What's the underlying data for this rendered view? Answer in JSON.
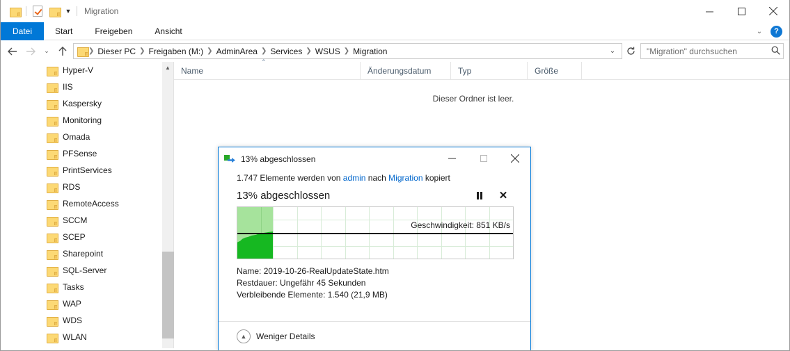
{
  "window": {
    "title": "Migration",
    "quick_access": [
      {
        "name": "folder-icon",
        "label": "Aktueller Ordner"
      },
      {
        "name": "properties-icon",
        "label": "Eigenschaften"
      },
      {
        "name": "new-folder-icon",
        "label": "Neuer Ordner"
      },
      {
        "name": "chevron-down-icon",
        "label": "Schnellzugriff anpassen"
      }
    ],
    "controls": {
      "minimize": "Minimieren",
      "maximize": "Maximieren",
      "close": "Schließen"
    }
  },
  "ribbon": {
    "tabs": [
      {
        "label": "Datei",
        "active": true
      },
      {
        "label": "Start",
        "active": false
      },
      {
        "label": "Freigeben",
        "active": false
      },
      {
        "label": "Ansicht",
        "active": false
      }
    ],
    "expand_icon": "chevron-down-icon",
    "help_label": "?"
  },
  "navigation": {
    "back": "◄",
    "forward": "►",
    "recent": "⌄",
    "up": "↑",
    "breadcrumbs": [
      "Dieser PC",
      "Freigaben (M:)",
      "AdminArea",
      "Services",
      "WSUS",
      "Migration"
    ],
    "dropdown_icon": "chevron-down-icon",
    "refresh_icon": "refresh-icon"
  },
  "search": {
    "placeholder": "\"Migration\" durchsuchen",
    "value": "",
    "icon": "search-icon"
  },
  "sidebar": {
    "items": [
      {
        "label": "Hyper-V"
      },
      {
        "label": "IIS"
      },
      {
        "label": "Kaspersky"
      },
      {
        "label": "Monitoring"
      },
      {
        "label": "Omada"
      },
      {
        "label": "PFSense"
      },
      {
        "label": "PrintServices"
      },
      {
        "label": "RDS"
      },
      {
        "label": "RemoteAccess"
      },
      {
        "label": "SCCM"
      },
      {
        "label": "SCEP"
      },
      {
        "label": "Sharepoint"
      },
      {
        "label": "SQL-Server"
      },
      {
        "label": "Tasks"
      },
      {
        "label": "WAP"
      },
      {
        "label": "WDS"
      },
      {
        "label": "WLAN"
      }
    ]
  },
  "filelist": {
    "columns": [
      {
        "label": "Name",
        "sorted": "asc"
      },
      {
        "label": "Änderungsdatum",
        "sorted": ""
      },
      {
        "label": "Typ",
        "sorted": ""
      },
      {
        "label": "Größe",
        "sorted": ""
      }
    ],
    "empty_message": "Dieser Ordner ist leer."
  },
  "copy_dialog": {
    "icon": "copy-icon",
    "title": "13% abgeschlossen",
    "controls": {
      "minimize": "Minimieren",
      "maximize": "Maximieren",
      "close": "Schließen"
    },
    "summary_prefix": "1.747 Elemente werden von ",
    "summary_source": "admin",
    "summary_middle": " nach ",
    "summary_target": "Migration",
    "summary_suffix": " kopiert",
    "percent_label": "13% abgeschlossen",
    "percent_value": 13,
    "pause_icon": "pause-icon",
    "cancel_icon": "close-icon",
    "speed_label": "Geschwindigkeit: 851 KB/s",
    "details": [
      {
        "key": "Name:",
        "value": "2019-10-26-RealUpdateState.htm"
      },
      {
        "key": "Restdauer:",
        "value": "Ungefähr 45 Sekunden"
      },
      {
        "key": "Verbleibende Elemente:",
        "value": "1.540 (21,9 MB)"
      }
    ],
    "footer_label": "Weniger Details",
    "footer_icon": "chevron-up-circle-icon",
    "colors": {
      "progress_light": "#a6e39c",
      "speed_fill": "#16b821",
      "accent": "#0078d7",
      "link": "#0066cc"
    }
  }
}
